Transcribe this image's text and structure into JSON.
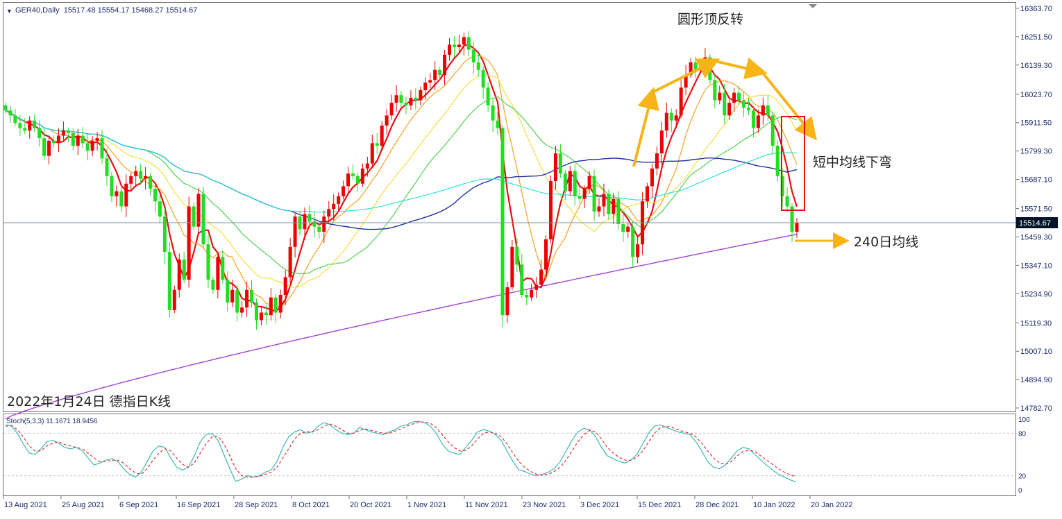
{
  "header": {
    "symbol_line": "GER40,Daily  15517.48 15554.17 15468.27 15514.67",
    "current_price": "15514.67",
    "corner_caption": "2022年1月24日 德指日K线"
  },
  "annotations": {
    "rounded_top": "圆形顶反转",
    "ma_bend": "短中均线下弯",
    "ma240": "240日均线"
  },
  "indicator": {
    "label": "Stoch(5,3,3) 11.1671 18.9456",
    "levels": [
      100,
      80,
      20,
      0
    ]
  },
  "colors": {
    "bull": "#ee0000",
    "bear": "#22dd22",
    "ma5": "#e81010",
    "ma10": "#f4a020",
    "ma20": "#f0e040",
    "ma30": "#50d050",
    "ma60": "#2030a0",
    "ma120": "#30e0e0",
    "ma240": "#a040d0",
    "arrow": "#f6b416",
    "stoch_main": "#3cb8b8",
    "stoch_signal": "#e03030"
  },
  "chart_data": {
    "type": "candlestick",
    "y_axis": {
      "range": [
        14782.7,
        16363.7
      ],
      "tick_labels": [
        "16363.70",
        "16251.50",
        "16139.30",
        "16023.70",
        "15911.50",
        "15799.30",
        "15687.10",
        "15571.50",
        "15459.30",
        "15347.10",
        "15234.90",
        "15119.30",
        "15007.10",
        "14894.90",
        "14782.70"
      ]
    },
    "x_axis": {
      "tick_labels": [
        "13 Aug 2021",
        "25 Aug 2021",
        "6 Sep 2021",
        "16 Sep 2021",
        "28 Sep 2021",
        "8 Oct 2021",
        "20 Oct 2021",
        "1 Nov 2021",
        "11 Nov 2021",
        "23 Nov 2021",
        "3 Dec 2021",
        "15 Dec 2021",
        "28 Dec 2021",
        "10 Jan 2022",
        "20 Jan 2022"
      ]
    },
    "candles_close": [
      15960,
      15940,
      15910,
      15890,
      15880,
      15920,
      15890,
      15850,
      15780,
      15840,
      15830,
      15860,
      15880,
      15870,
      15820,
      15860,
      15830,
      15800,
      15840,
      15850,
      15770,
      15700,
      15620,
      15640,
      15580,
      15670,
      15700,
      15720,
      15690,
      15700,
      15650,
      15600,
      15540,
      15400,
      15170,
      15250,
      15370,
      15290,
      15580,
      15500,
      15630,
      15430,
      15290,
      15250,
      15380,
      15290,
      15200,
      15250,
      15160,
      15180,
      15250,
      15200,
      15130,
      15160,
      15150,
      15220,
      15160,
      15230,
      15300,
      15420,
      15540,
      15490,
      15550,
      15520,
      15500,
      15480,
      15540,
      15570,
      15590,
      15620,
      15660,
      15710,
      15700,
      15670,
      15730,
      15750,
      15830,
      15820,
      15900,
      15940,
      15990,
      16020,
      15990,
      15980,
      16010,
      16000,
      16040,
      16070,
      16080,
      16120,
      16100,
      16180,
      16220,
      16210,
      16220,
      16250,
      16200,
      16150,
      16120,
      16050,
      15980,
      15920,
      15890,
      15150,
      15260,
      15420,
      15350,
      15230,
      15220,
      15250,
      15270,
      15330,
      15450,
      15680,
      15790,
      15710,
      15640,
      15720,
      15620,
      15610,
      15650,
      15700,
      15560,
      15580,
      15630,
      15550,
      15610,
      15510,
      15480,
      15500,
      15380,
      15430,
      15600,
      15660,
      15730,
      15790,
      15880,
      15950,
      15920,
      15940,
      16050,
      16100,
      16150,
      16120,
      16130,
      16170,
      16080,
      16000,
      16030,
      15940,
      15990,
      16030,
      16000,
      15970,
      15960,
      15890,
      15940,
      15980,
      15940,
      15820,
      15700,
      15620,
      15580,
      15480,
      15514.67
    ],
    "series": [
      {
        "name": "MA5"
      },
      {
        "name": "MA10"
      },
      {
        "name": "MA20"
      },
      {
        "name": "MA30"
      },
      {
        "name": "MA60"
      },
      {
        "name": "MA120"
      },
      {
        "name": "MA240"
      }
    ],
    "stoch": {
      "range": [
        0,
        100
      ],
      "main": [
        92,
        90,
        80,
        65,
        52,
        50,
        58,
        68,
        70,
        66,
        60,
        58,
        60,
        55,
        45,
        35,
        38,
        42,
        44,
        40,
        30,
        22,
        18,
        25,
        40,
        55,
        62,
        60,
        45,
        32,
        28,
        32,
        48,
        68,
        78,
        80,
        70,
        50,
        30,
        12,
        15,
        20,
        18,
        20,
        25,
        28,
        40,
        60,
        75,
        82,
        85,
        80,
        82,
        90,
        95,
        92,
        85,
        80,
        78,
        80,
        88,
        85,
        82,
        80,
        78,
        82,
        85,
        90,
        92,
        96,
        97,
        95,
        90,
        80,
        65,
        55,
        52,
        50,
        60,
        70,
        82,
        85,
        83,
        78,
        70,
        55,
        40,
        28,
        26,
        22,
        20,
        22,
        25,
        30,
        40,
        55,
        70,
        82,
        87,
        85,
        75,
        60,
        48,
        44,
        40,
        38,
        42,
        50,
        65,
        80,
        90,
        92,
        88,
        85,
        82,
        80,
        78,
        68,
        55,
        40,
        32,
        30,
        35,
        45,
        55,
        60,
        58,
        50,
        42,
        35,
        28,
        22,
        18,
        14,
        11.1671
      ],
      "signal": [
        90,
        91,
        85,
        75,
        62,
        55,
        55,
        62,
        66,
        68,
        64,
        62,
        60,
        58,
        52,
        45,
        40,
        40,
        42,
        42,
        38,
        30,
        24,
        22,
        30,
        42,
        52,
        58,
        55,
        45,
        36,
        32,
        38,
        52,
        65,
        75,
        76,
        65,
        48,
        30,
        20,
        18,
        18,
        19,
        22,
        25,
        32,
        45,
        58,
        72,
        80,
        82,
        82,
        85,
        90,
        93,
        90,
        85,
        80,
        80,
        84,
        86,
        84,
        82,
        80,
        80,
        83,
        86,
        90,
        93,
        95,
        96,
        94,
        88,
        78,
        68,
        60,
        55,
        56,
        62,
        72,
        80,
        82,
        80,
        75,
        65,
        52,
        40,
        32,
        26,
        22,
        21,
        22,
        26,
        32,
        42,
        55,
        68,
        78,
        84,
        82,
        72,
        60,
        52,
        46,
        42,
        42,
        46,
        55,
        68,
        80,
        88,
        90,
        88,
        85,
        82,
        80,
        75,
        66,
        55,
        45,
        38,
        36,
        40,
        48,
        54,
        56,
        54,
        48,
        42,
        36,
        30,
        25,
        21,
        18.9456
      ]
    }
  }
}
